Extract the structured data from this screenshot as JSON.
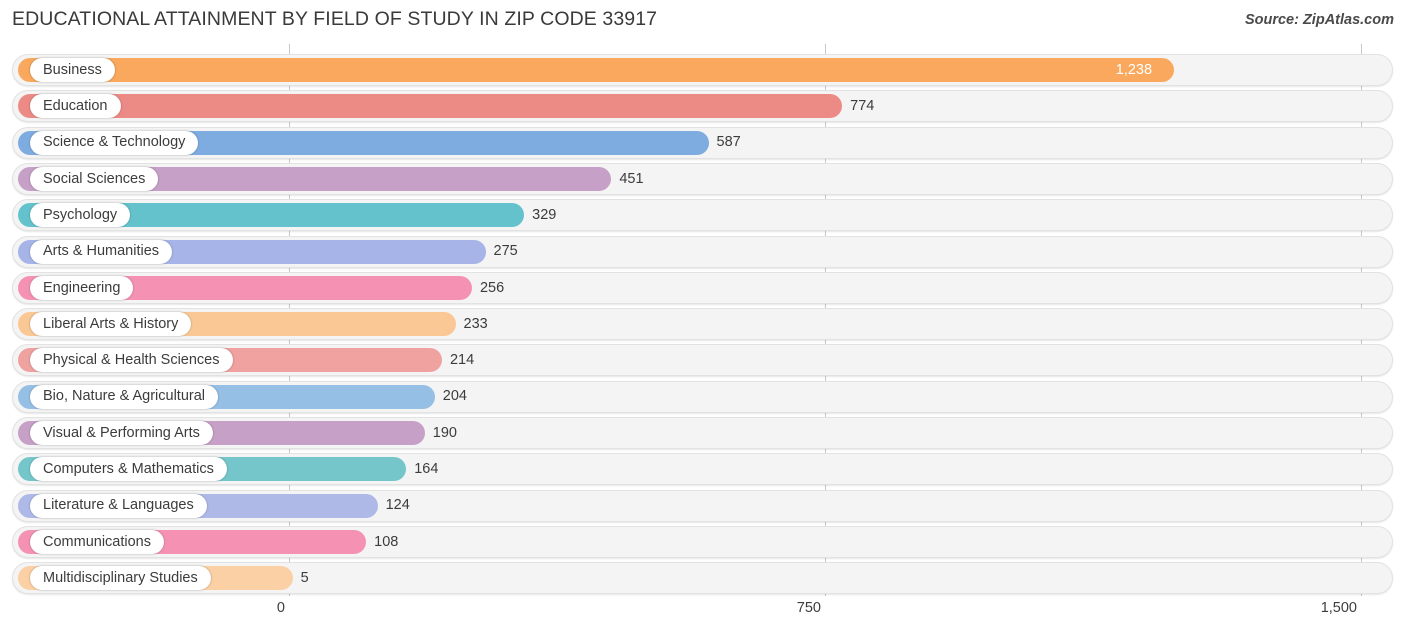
{
  "header": {
    "title": "EDUCATIONAL ATTAINMENT BY FIELD OF STUDY IN ZIP CODE 33917",
    "source": "Source: ZipAtlas.com"
  },
  "chart_data": {
    "type": "bar",
    "orientation": "horizontal",
    "title": "EDUCATIONAL ATTAINMENT BY FIELD OF STUDY IN ZIP CODE 33917",
    "xlabel": "",
    "ylabel": "",
    "xlim": [
      0,
      1500
    ],
    "ticks": [
      "0",
      "750",
      "1,500"
    ],
    "tick_values": [
      0,
      750,
      1500
    ],
    "grid": true,
    "legend": false,
    "categories": [
      "Business",
      "Education",
      "Science & Technology",
      "Social Sciences",
      "Psychology",
      "Arts & Humanities",
      "Engineering",
      "Liberal Arts & History",
      "Physical & Health Sciences",
      "Bio, Nature & Agricultural",
      "Visual & Performing Arts",
      "Computers & Mathematics",
      "Literature & Languages",
      "Communications",
      "Multidisciplinary Studies"
    ],
    "values": [
      1238,
      774,
      587,
      451,
      329,
      275,
      256,
      233,
      214,
      204,
      190,
      164,
      124,
      108,
      5
    ],
    "value_labels": [
      "1,238",
      "774",
      "587",
      "451",
      "329",
      "275",
      "256",
      "233",
      "214",
      "204",
      "190",
      "164",
      "124",
      "108",
      "5"
    ],
    "colors": [
      "#F9A85D",
      "#EC8A86",
      "#7EACE0",
      "#C6A0C6",
      "#63C2CC",
      "#A6B4E8",
      "#F592B4",
      "#FAC894",
      "#EFA2A0",
      "#95BFE4",
      "#C6A0C6",
      "#74C6CB",
      "#AEB9E8",
      "#F592B4",
      "#FBD0A4"
    ],
    "label_inside_bar": [
      true,
      false,
      false,
      false,
      false,
      false,
      false,
      false,
      false,
      false,
      false,
      false,
      false,
      false,
      false
    ]
  }
}
